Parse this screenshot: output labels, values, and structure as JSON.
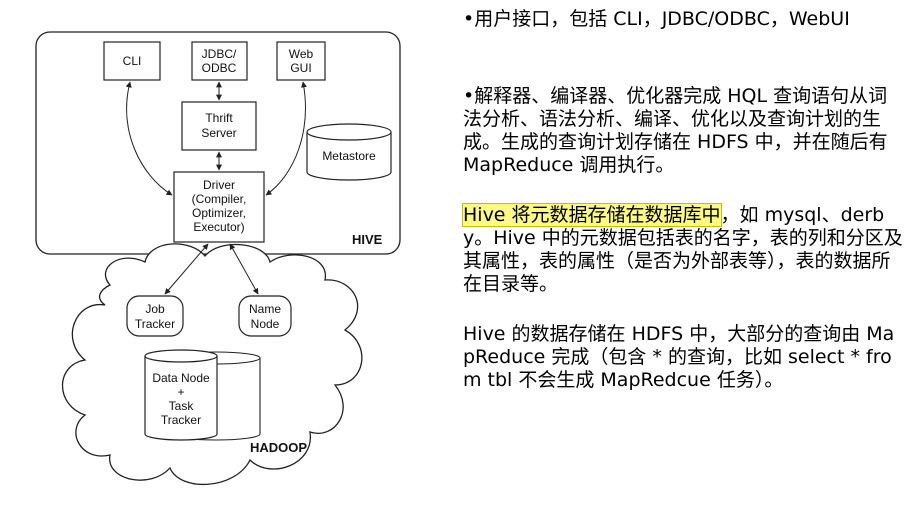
{
  "diagram": {
    "hive": {
      "label": "HIVE",
      "cli": "CLI",
      "jdbc_line1": "JDBC/",
      "jdbc_line2": "ODBC",
      "web_line1": "Web",
      "web_line2": "GUI",
      "thrift_line1": "Thrift",
      "thrift_line2": "Server",
      "metastore": "Metastore",
      "driver_line1": "Driver",
      "driver_line2": "(Compiler,",
      "driver_line3": "Optimizer,",
      "driver_line4": "Executor)"
    },
    "hadoop": {
      "label": "HADOOP",
      "job_line1": "Job",
      "job_line2": "Tracker",
      "name_line1": "Name",
      "name_line2": "Node",
      "data_line1": "Data Node",
      "data_line2": "+",
      "data_line3": "Task",
      "data_line4": "Tracker"
    }
  },
  "text": {
    "p1": "•用户接口，包括 CLI，JDBC/ODBC，WebUI",
    "p2": "•解释器、编译器、优化器完成 HQL 查询语句从词法分析、语法分析、编译、优化以及查询计划的生成。生成的查询计划存储在 HDFS 中，并在随后有 MapReduce 调用执行。",
    "p3_highlight": "Hive 将元数据存储在数据库中",
    "p3_rest": "，如 mysql、derby。Hive 中的元数据包括表的名字，表的列和分区及其属性，表的属性（是否为外部表等），表的数据所在目录等。",
    "p4": "Hive 的数据存储在 HDFS 中，大部分的查询由 MapReduce 完成（包含 * 的查询，比如 select * from tbl 不会生成 MapRedcue 任务）。"
  },
  "colors": {
    "highlight": "#fcf986"
  }
}
